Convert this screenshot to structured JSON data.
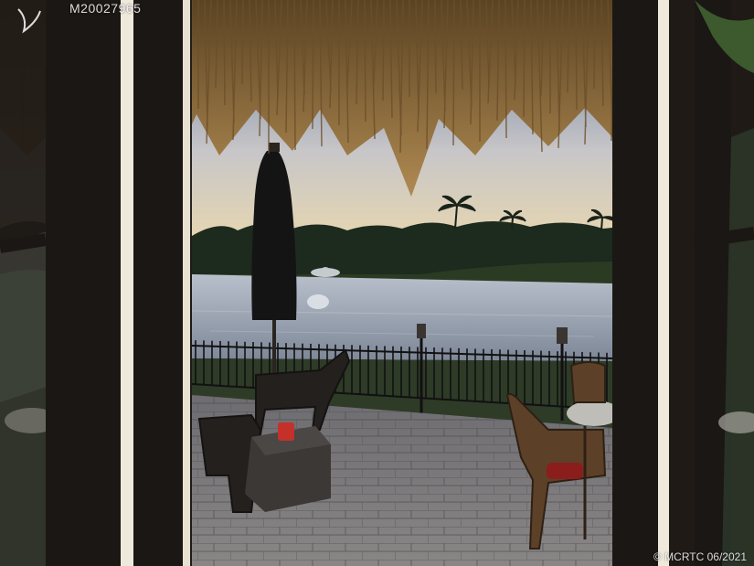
{
  "photo": {
    "listing_id": "M20027965",
    "copyright": "© MCRTC 06/2021",
    "colors": {
      "sky_top": "#5a6f93",
      "sky_horizon": "#f2dca8",
      "water": "#9aa6b6",
      "treeline": "#1d2a1e",
      "thatch": "#8a6a3c",
      "frame": "#1f1a16",
      "pavers": "#6e6e72"
    }
  }
}
